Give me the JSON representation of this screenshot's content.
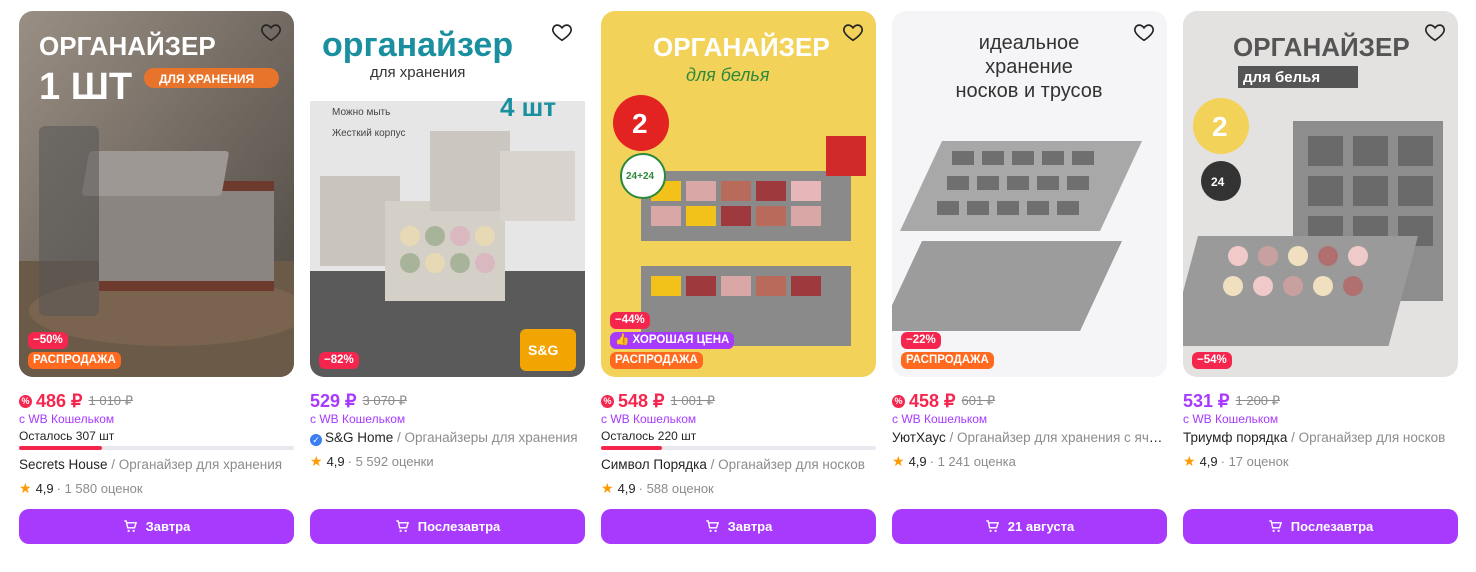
{
  "colors": {
    "accent": "#a73afd",
    "sale_red": "#f5264e",
    "sale_orange": "#ff6a1f",
    "rating_star": "#ff9900"
  },
  "products": [
    {
      "image_text": "ОРГАНАЙЗЕР 1 ШТ ДЛЯ ХРАНЕНИЯ",
      "discount": "−50%",
      "badges": [
        "РАСПРОДАЖА"
      ],
      "price": "486 ₽",
      "old_price": "1 010 ₽",
      "wallet": "с WB Кошельком",
      "stock": "Осталось 307 шт",
      "stock_fraction": 0.3,
      "brand": "Secrets House",
      "category": " / Органайзер для хранения",
      "rating": "4,9",
      "reviews": "· 1 580 оценок",
      "button": "Завтра"
    },
    {
      "image_text": "органайзер для хранения 4 шт",
      "discount": "−82%",
      "badges": [],
      "price": "529 ₽",
      "old_price": "3 070 ₽",
      "wallet": "с WB Кошельком",
      "brand": "S&G Home",
      "category": " / Органайзеры для хранения",
      "rating": "4,9",
      "reviews": "· 5 592 оценки",
      "button": "Послезавтра"
    },
    {
      "image_text": "ОРГАНАЙЗЕР для белья 2 штуки",
      "discount": "−44%",
      "badges": [
        "ХОРОШАЯ ЦЕНА",
        "РАСПРОДАЖА"
      ],
      "price": "548 ₽",
      "old_price": "1 001 ₽",
      "wallet": "с WB Кошельком",
      "stock": "Осталось 220 шт",
      "stock_fraction": 0.22,
      "brand": "Символ Порядка",
      "category": " / Органайзер для носков",
      "rating": "4,9",
      "reviews": "· 588 оценок",
      "button": "Завтра"
    },
    {
      "image_text": "идеальное хранение носков и трусов",
      "discount": "−22%",
      "badges": [
        "РАСПРОДАЖА"
      ],
      "price": "458 ₽",
      "old_price": "601 ₽",
      "wallet": "с WB Кошельком",
      "brand": "УютХаус",
      "category": " / Органайзер для хранения с ячейками",
      "rating": "4,9",
      "reviews": "· 1 241 оценка",
      "button": "21 августа"
    },
    {
      "image_text": "ОРГАНАЙЗЕР для белья 2 штуки",
      "discount": "−54%",
      "badges": [],
      "price": "531 ₽",
      "old_price": "1 200 ₽",
      "wallet": "с WB Кошельком",
      "brand": "Триумф порядка",
      "category": " / Органайзер для носков",
      "rating": "4,9",
      "reviews": "· 17 оценок",
      "button": "Послезавтра"
    }
  ]
}
